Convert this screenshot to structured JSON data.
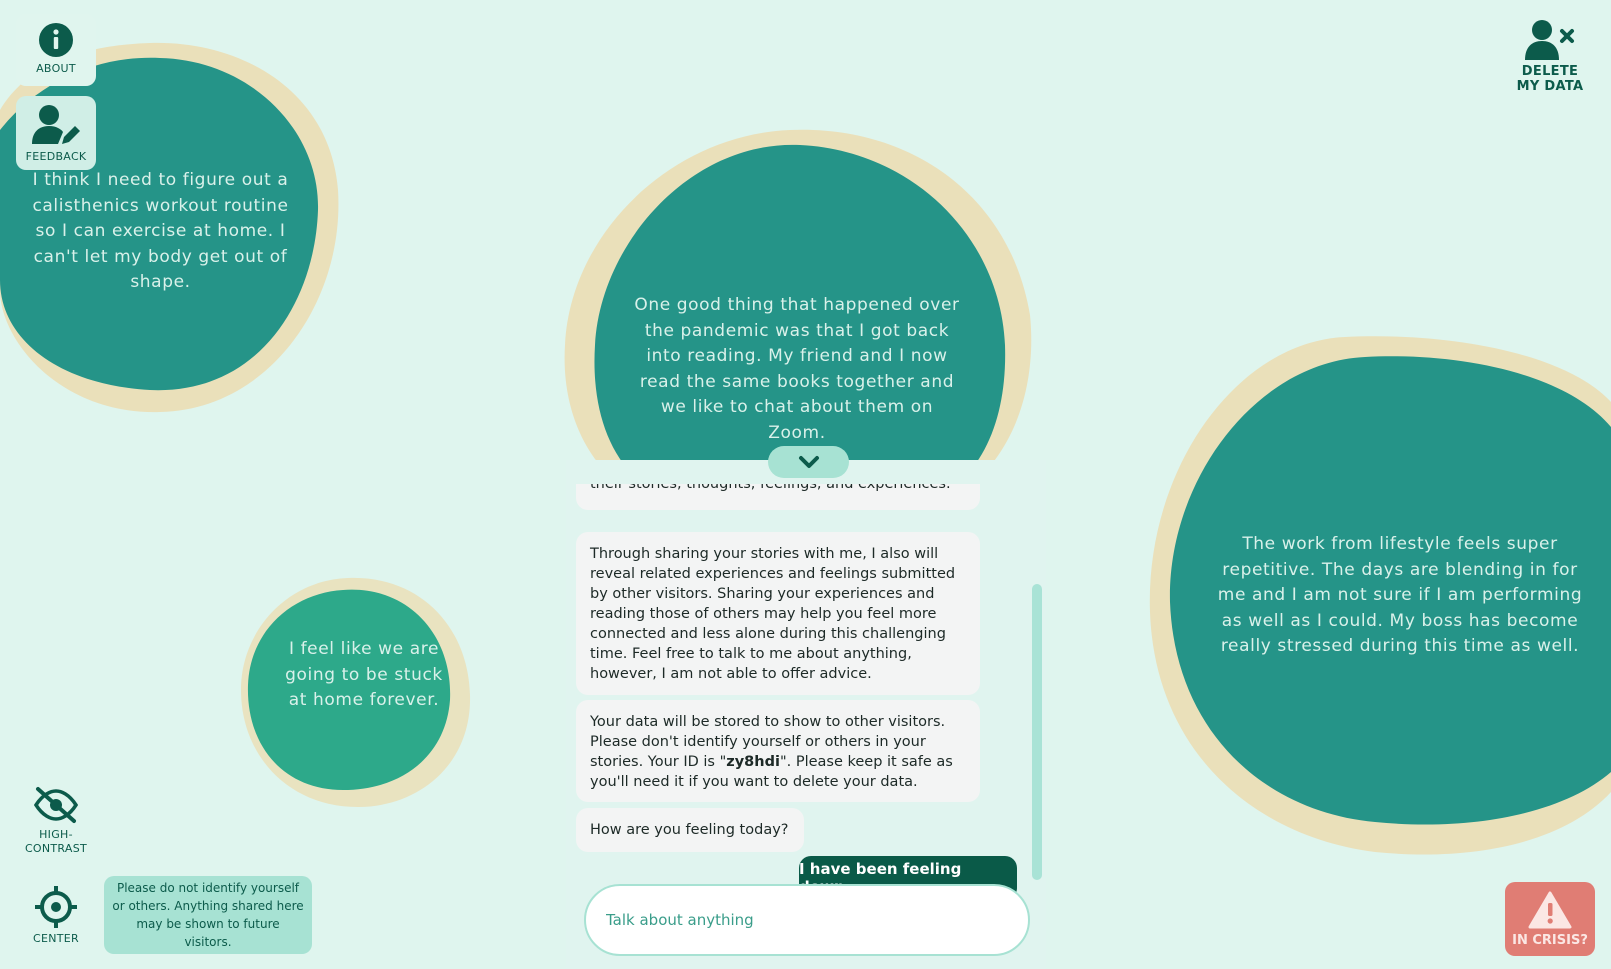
{
  "nav": {
    "about_label": "ABOUT",
    "feedback_label": "FEEDBACK",
    "contrast_label_line1": "HIGH-",
    "contrast_label_line2": "CONTRAST",
    "center_label": "CENTER",
    "delete_label_line1": "DELETE",
    "delete_label_line2": "MY DATA",
    "crisis_label": "IN CRISIS?"
  },
  "privacy_note": "Please do not identify yourself or others. Anything shared here may be shown to future visitors.",
  "stories": [
    "I think I need to figure out a calisthenics workout routine so I can exercise at home. I can't let my body get out of shape.",
    "One good thing that happened over the pandemic was that I got back into reading. My friend and I now read the same books together and we like to chat about them on Zoom.",
    "The work from lifestyle feels super repetitive. The days are blending in for me and I am not sure if I am performing as well as I could. My boss has become really stressed during this time as well.",
    "I feel like we are going to be stuck at home forever."
  ],
  "chat": {
    "messages": [
      "their stories, thoughts, feelings, and experiences.",
      "Through sharing your stories with me, I also will reveal related experiences and feelings submitted by other visitors. Sharing your experiences and reading those of others may help you feel more connected and less alone during this challenging time. Feel free to talk to me about anything, however, I am not able to offer advice.",
      "How are you feeling today?"
    ],
    "data_notice_before": "Your data will be stored to show to other visitors. Please don't identify yourself or others in your stories. Your ID is \"",
    "user_id": "zy8hdi",
    "data_notice_after": "\". Please keep it safe as you'll need it if you want to delete your data.",
    "user_message": "I have been feeling down.",
    "input_placeholder": "Talk about anything"
  },
  "colors": {
    "background": "#dff5ee",
    "blob_teal": "#259488",
    "blob_green": "#2da98a",
    "blob_sand": "#ecdcb0",
    "primary_dark": "#0a5a48",
    "crisis": "#e07d74"
  },
  "icons": [
    "info-icon",
    "user-edit-icon",
    "user-remove-icon",
    "eye-slash-icon",
    "crosshair-icon",
    "chevron-down-icon",
    "warning-icon"
  ]
}
